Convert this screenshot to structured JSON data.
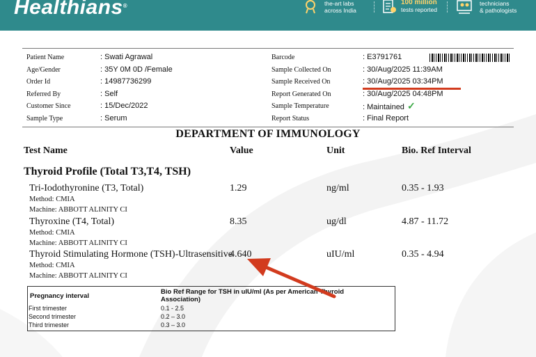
{
  "header": {
    "logo": "Healthians",
    "logo_mark": "®",
    "stats": [
      {
        "icon": "lab-icon",
        "big": "",
        "line1": "the-art labs",
        "line2": "across India"
      },
      {
        "icon": "report-icon",
        "big": "100 million",
        "line1": "tests reported",
        "line2": ""
      },
      {
        "icon": "technicians-icon",
        "big": "",
        "line1": "technicians",
        "line2": "& pathologists"
      }
    ]
  },
  "patient": {
    "left": [
      {
        "label": "Patient Name",
        "value": ": Swati Agrawal"
      },
      {
        "label": "Age/Gender",
        "value": ": 35Y 0M 0D /Female"
      },
      {
        "label": "Order Id",
        "value": ": 14987736299"
      },
      {
        "label": "Referred By",
        "value": ": Self"
      },
      {
        "label": "Customer Since",
        "value": ": 15/Dec/2022"
      },
      {
        "label": "Sample Type",
        "value": ": Serum"
      }
    ],
    "right": [
      {
        "label": "Barcode",
        "value": ": E3791761"
      },
      {
        "label": "Sample Collected On",
        "value": ": 30/Aug/2025 11:39AM"
      },
      {
        "label": "Sample Received On",
        "value": ": 30/Aug/2025 03:34PM"
      },
      {
        "label": "Report Generated On",
        "value": ": 30/Aug/2025 04:48PM"
      },
      {
        "label": "Sample Temperature",
        "value": ": Maintained"
      },
      {
        "label": "Report Status",
        "value": ": Final Report"
      }
    ]
  },
  "department": "DEPARTMENT OF IMMUNOLOGY",
  "columns": {
    "test": "Test Name",
    "value": "Value",
    "unit": "Unit",
    "ref": "Bio. Ref Interval"
  },
  "profile": "Thyroid Profile (Total T3,T4, TSH)",
  "tests": [
    {
      "name": "Tri-Iodothyronine (T3, Total)",
      "method": "Method: CMIA",
      "machine": "Machine: ABBOTT ALINITY CI",
      "value": "1.29",
      "unit": "ng/ml",
      "ref": "0.35 - 1.93"
    },
    {
      "name": "Thyroxine (T4, Total)",
      "method": "Method: CMIA",
      "machine": "Machine: ABBOTT ALINITY CI",
      "value": "8.35",
      "unit": "ug/dl",
      "ref": "4.87 - 11.72"
    },
    {
      "name": "Thyroid Stimulating Hormone (TSH)-Ultrasensitive",
      "method": "Method: CMIA",
      "machine": "Machine: ABBOTT ALINITY CI",
      "value": "4.640",
      "unit": "uIU/ml",
      "ref": "0.35 - 4.94"
    }
  ],
  "pregnancy": {
    "col1": "Pregnancy interval",
    "col2": "Bio Ref Range for TSH in uIU/ml (As per American Thyroid Association)",
    "rows": [
      {
        "interval": "First trimester",
        "range": "0.1 - 2.5"
      },
      {
        "interval": "Second trimester",
        "range": "0.2 – 3.0"
      },
      {
        "interval": "Third trimester",
        "range": "0.3 – 3.0"
      }
    ]
  },
  "colors": {
    "header": "#2f8a8c",
    "annotation": "#d23b1e",
    "check": "#3aa845"
  }
}
